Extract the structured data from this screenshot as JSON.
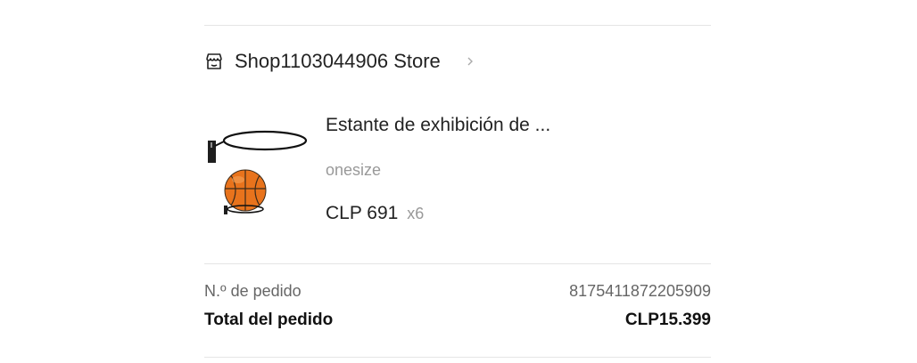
{
  "store": {
    "name": "Shop1103044906 Store",
    "icon": "store-icon",
    "chevron_icon": "chevron-right-icon"
  },
  "product": {
    "title": "Estante de exhibición de ...",
    "variant": "onesize",
    "price": "CLP 691",
    "quantity": "x6",
    "image_icon": "basketball-wall-rack-image"
  },
  "order": {
    "number_label": "N.º de pedido",
    "number_value": "8175411872205909",
    "total_label": "Total del pedido",
    "total_value": "CLP15.399"
  },
  "colors": {
    "divider": "#e5e5e5",
    "muted_text": "#999999",
    "ball": "#e8731c"
  }
}
